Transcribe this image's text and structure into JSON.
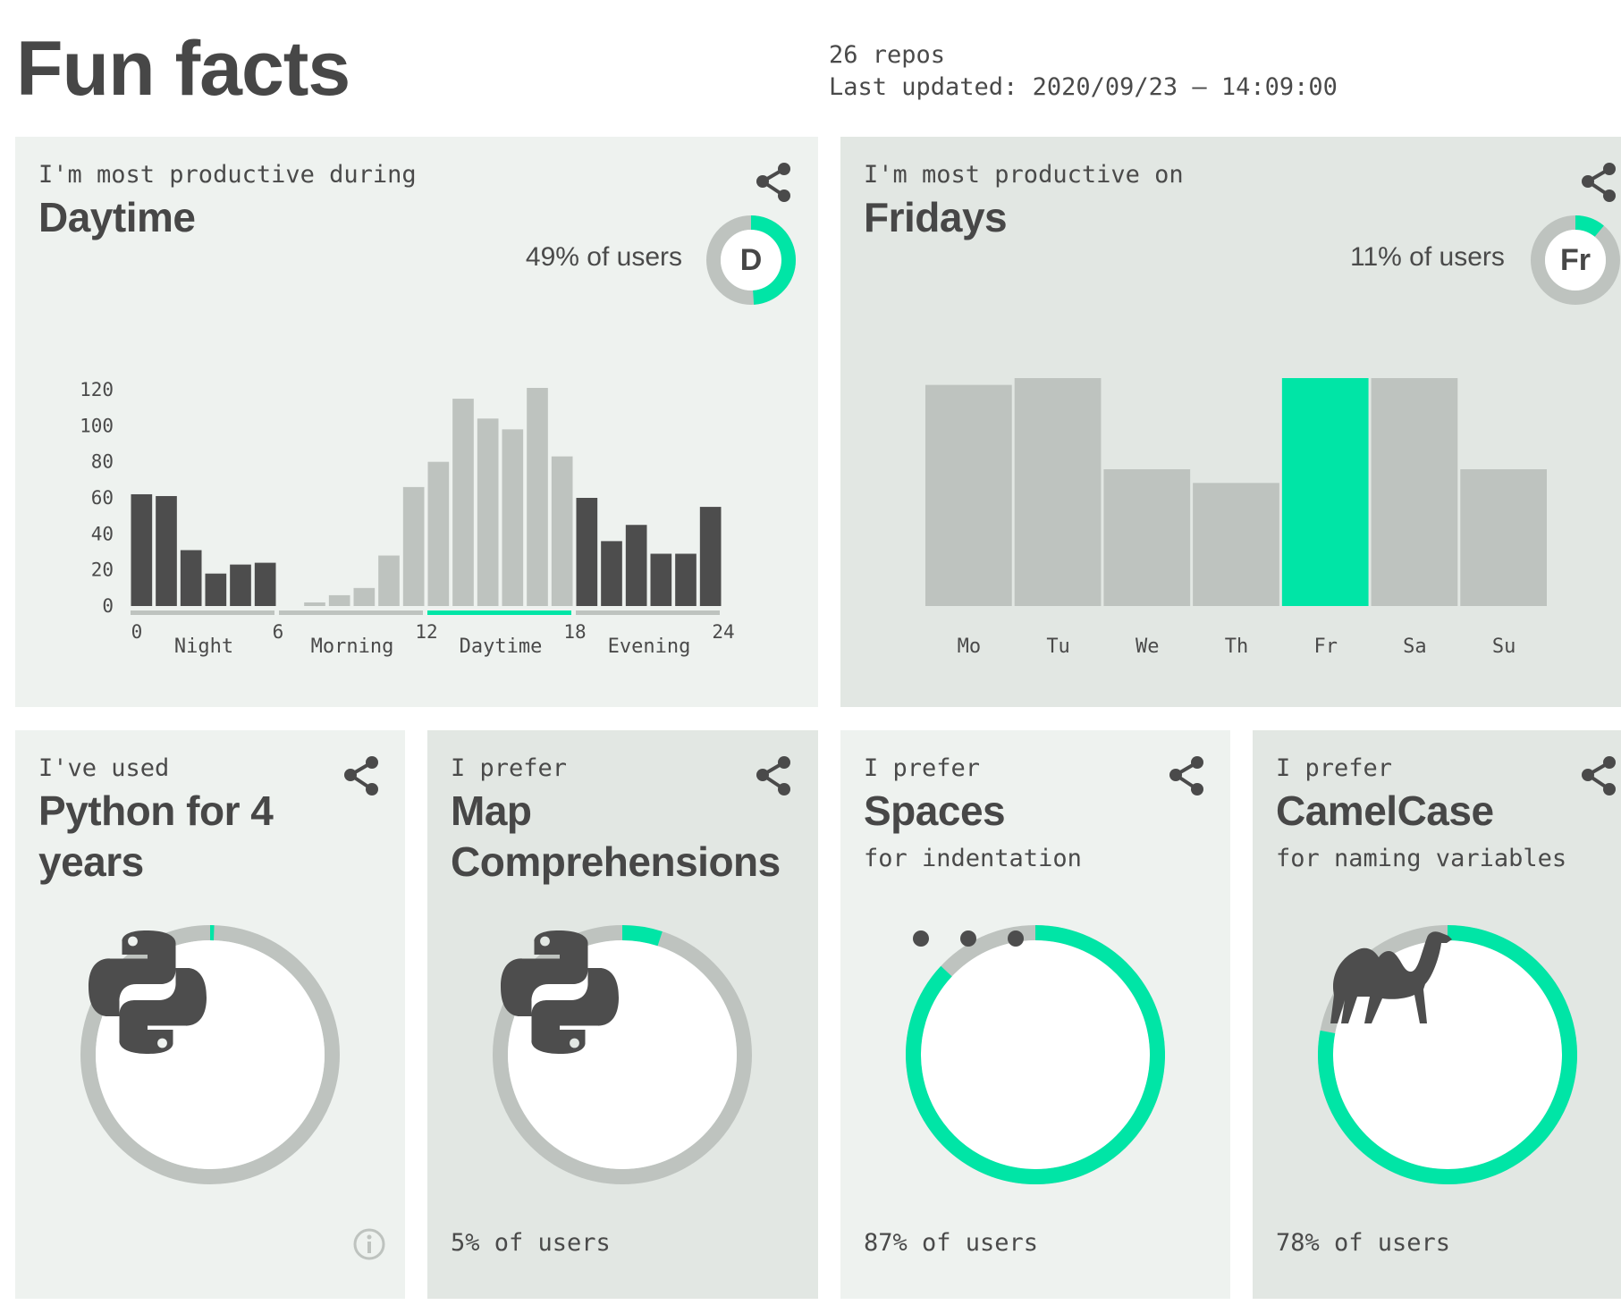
{
  "header": {
    "title": "Fun facts",
    "repos": "26 repos",
    "last_updated": "Last updated: 2020/09/23 – 14:09:00"
  },
  "colors": {
    "accent": "#00e5a6",
    "dark_bar": "#4d4d4d",
    "light_bar": "#bec3bf",
    "card_light": "#eef2ef",
    "card_dark": "#e2e7e3"
  },
  "cards": {
    "time": {
      "lead": "I'm most productive during",
      "headline": "Daytime",
      "share_percent": "49% of users",
      "badge_letter": "D",
      "badge_fraction": 0.49
    },
    "day": {
      "lead": "I'm most productive on",
      "headline": "Fridays",
      "share_percent": "11% of users",
      "badge_letter": "Fr",
      "badge_fraction": 0.11
    },
    "python": {
      "lead": "I've used",
      "headline": "Python for 4 years",
      "icon": "python-logo-icon",
      "ring_fraction": 0.005
    },
    "map": {
      "lead": "I prefer",
      "headline": "Map Comprehensions",
      "footer": "5% of users",
      "icon": "python-logo-icon",
      "ring_fraction": 0.05
    },
    "spaces": {
      "lead": "I prefer",
      "headline": "Spaces",
      "subtitle": "for indentation",
      "footer": "87% of users",
      "icon": "dots-icon",
      "ring_fraction": 0.87
    },
    "camel": {
      "lead": "I prefer",
      "headline": "CamelCase",
      "subtitle": "for naming variables",
      "footer": "78% of users",
      "icon": "camel-icon",
      "ring_fraction": 0.78
    }
  },
  "chart_data": [
    {
      "type": "bar",
      "title": "",
      "x": [
        0,
        1,
        2,
        3,
        4,
        5,
        6,
        7,
        8,
        9,
        10,
        11,
        12,
        13,
        14,
        15,
        16,
        17,
        18,
        19,
        20,
        21,
        22,
        23
      ],
      "values": [
        62,
        61,
        31,
        18,
        23,
        24,
        0,
        2,
        6,
        10,
        28,
        66,
        80,
        115,
        104,
        98,
        121,
        83,
        60,
        36,
        45,
        29,
        29,
        55
      ],
      "x_ticks": [
        "0",
        "6",
        "12",
        "18",
        "24"
      ],
      "y_ticks": [
        "0",
        "20",
        "40",
        "60",
        "80",
        "100",
        "120"
      ],
      "ylim": [
        0,
        125
      ],
      "groups": [
        {
          "label": "Night",
          "range": [
            0,
            6
          ],
          "highlight": false
        },
        {
          "label": "Morning",
          "range": [
            6,
            12
          ],
          "highlight": false
        },
        {
          "label": "Daytime",
          "range": [
            12,
            18
          ],
          "highlight": true
        },
        {
          "label": "Evening",
          "range": [
            18,
            24
          ],
          "highlight": false
        }
      ]
    },
    {
      "type": "bar",
      "title": "",
      "categories": [
        "Mo",
        "Tu",
        "We",
        "Th",
        "Fr",
        "Sa",
        "Su"
      ],
      "values": [
        97,
        100,
        60,
        54,
        100,
        100,
        60
      ],
      "highlight": "Fr",
      "ylim": [
        0,
        100
      ]
    }
  ]
}
